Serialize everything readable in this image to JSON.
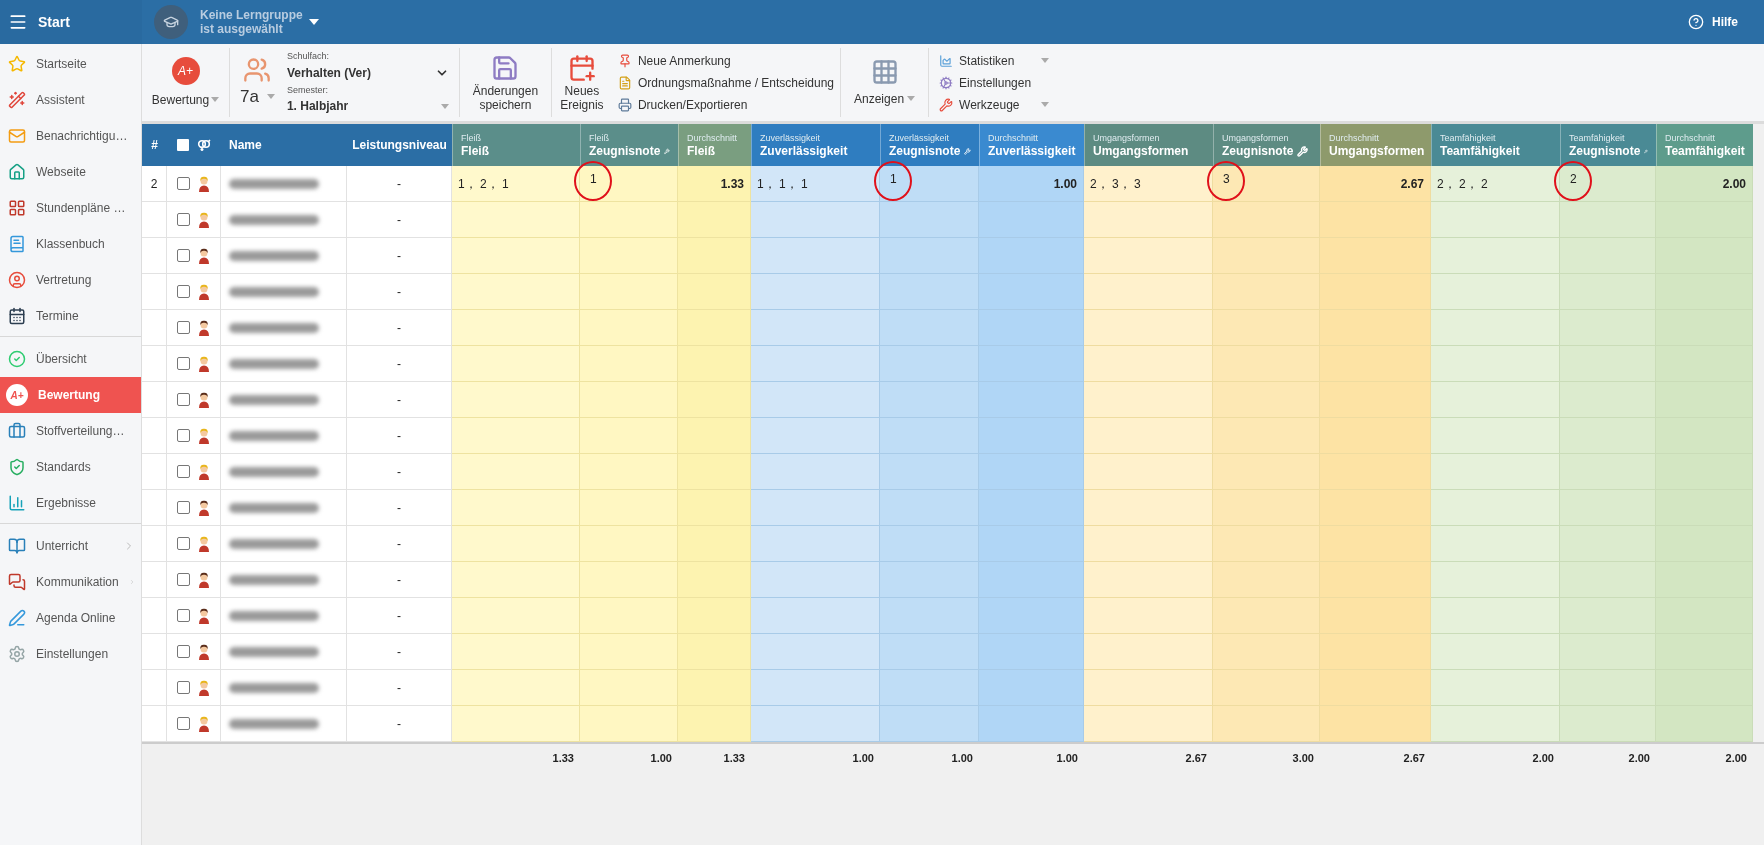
{
  "topbar": {
    "menu_label": "Start",
    "group_line1": "Keine Lerngruppe",
    "group_line2": "ist ausgewählt",
    "help": "Hilfe"
  },
  "sidebar": {
    "groups": [
      [
        {
          "label": "Startseite",
          "selected": false
        },
        {
          "label": "Assistent",
          "selected": false
        },
        {
          "label": "Benachrichtigu…",
          "selected": false
        },
        {
          "label": "Webseite",
          "selected": false
        },
        {
          "label": "Stundenpläne …",
          "selected": false
        },
        {
          "label": "Klassenbuch",
          "selected": false
        },
        {
          "label": "Vertretung",
          "selected": false
        },
        {
          "label": "Termine",
          "selected": false
        }
      ],
      [
        {
          "label": "Übersicht",
          "selected": false
        },
        {
          "label": "Bewertung",
          "badge": "A+",
          "selected": true
        },
        {
          "label": "Stoffverteilung…",
          "selected": false
        },
        {
          "label": "Standards",
          "selected": false
        },
        {
          "label": "Ergebnisse",
          "selected": false
        }
      ],
      [
        {
          "label": "Unterricht",
          "selected": false,
          "submenu": true
        },
        {
          "label": "Kommunikation",
          "selected": false,
          "submenu": true
        },
        {
          "label": "Agenda Online",
          "selected": false,
          "submenu": false
        },
        {
          "label": "Einstellungen",
          "selected": false,
          "submenu": false
        }
      ]
    ]
  },
  "toolbar": {
    "grading": {
      "badge": "A+",
      "label": "Bewertung"
    },
    "class_name": "7a",
    "subject_label": "Schulfach:",
    "subject": "Verhalten (Ver)",
    "semester_label": "Semester:",
    "semester": "1. Halbjahr",
    "save_line1": "Änderungen",
    "save_line2": "speichern",
    "event_line1": "Neues",
    "event_line2": "Ereignis",
    "actions": [
      {
        "label": "Neue Anmerkung"
      },
      {
        "label": "Ordnungsmaßnahme / Entscheidung"
      },
      {
        "label": "Drucken/Exportieren"
      }
    ],
    "view_label": "Anzeigen",
    "tools": [
      {
        "label": "Statistiken",
        "dropdown": true
      },
      {
        "label": "Einstellungen",
        "dropdown": false
      },
      {
        "label": "Werkzeuge",
        "dropdown": true
      }
    ]
  },
  "table": {
    "fixed_columns": [
      "#",
      "Name",
      "Leistungsniveau"
    ],
    "select_all_checked": false,
    "categories": [
      {
        "columns": [
          {
            "kind": "entries",
            "sub": "Fleiß",
            "label": "Fleiß"
          },
          {
            "kind": "grade",
            "sub": "Fleiß",
            "label": "Zeugnisnote"
          },
          {
            "kind": "average",
            "sub": "Durchschnitt",
            "label": "Fleiß"
          }
        ]
      },
      {
        "columns": [
          {
            "kind": "entries",
            "sub": "Zuverlässigkeit",
            "label": "Zuverlässigkeit"
          },
          {
            "kind": "grade",
            "sub": "Zuverlässigkeit",
            "label": "Zeugnisnote"
          },
          {
            "kind": "average",
            "sub": "Durchschnitt",
            "label": "Zuverlässigkeit"
          }
        ]
      },
      {
        "columns": [
          {
            "kind": "entries",
            "sub": "Umgangsformen",
            "label": "Umgangsformen"
          },
          {
            "kind": "grade",
            "sub": "Umgangsformen",
            "label": "Zeugnisnote"
          },
          {
            "kind": "average",
            "sub": "Durchschnitt",
            "label": "Umgangsformen"
          }
        ]
      },
      {
        "columns": [
          {
            "kind": "entries",
            "sub": "Teamfähigkeit",
            "label": "Teamfähigkeit"
          },
          {
            "kind": "grade",
            "sub": "Teamfähigkeit",
            "label": "Zeugnisnote"
          },
          {
            "kind": "average",
            "sub": "Durchschnitt",
            "label": "Teamfähigkeit"
          }
        ]
      }
    ],
    "rows": [
      {
        "number": "2",
        "kind": "female",
        "checked": false,
        "level": "-",
        "cells": [
          {
            "value": "1， 2， 1",
            "circled": false
          },
          {
            "value": "1",
            "circled": true
          },
          {
            "value": "1.33",
            "circled": false
          },
          {
            "value": "1， 1， 1",
            "circled": false
          },
          {
            "value": "1",
            "circled": true
          },
          {
            "value": "1.00",
            "circled": false
          },
          {
            "value": "2， 3， 3",
            "circled": false
          },
          {
            "value": "3",
            "circled": true
          },
          {
            "value": "2.67",
            "circled": false
          },
          {
            "value": "2， 2， 2",
            "circled": false
          },
          {
            "value": "2",
            "circled": true
          },
          {
            "value": "2.00",
            "circled": false
          }
        ]
      },
      {
        "kind": "female",
        "checked": false,
        "level": "-"
      },
      {
        "kind": "male",
        "checked": false,
        "level": "-"
      },
      {
        "kind": "female",
        "checked": false,
        "level": "-"
      },
      {
        "kind": "male",
        "checked": false,
        "level": "-"
      },
      {
        "kind": "female",
        "checked": false,
        "level": "-"
      },
      {
        "kind": "male",
        "checked": false,
        "level": "-"
      },
      {
        "kind": "female",
        "checked": false,
        "level": "-"
      },
      {
        "kind": "female",
        "checked": false,
        "level": "-"
      },
      {
        "kind": "male",
        "checked": false,
        "level": "-"
      },
      {
        "kind": "female",
        "checked": false,
        "level": "-"
      },
      {
        "kind": "male",
        "checked": false,
        "level": "-"
      },
      {
        "kind": "male",
        "checked": false,
        "level": "-"
      },
      {
        "kind": "male",
        "checked": false,
        "level": "-"
      },
      {
        "kind": "female",
        "checked": false,
        "level": "-"
      },
      {
        "kind": "female",
        "checked": false,
        "level": "-"
      }
    ],
    "totals": [
      "1.33",
      "1.00",
      "1.33",
      "1.00",
      "1.00",
      "1.00",
      "2.67",
      "3.00",
      "2.67",
      "2.00",
      "2.00",
      "2.00"
    ]
  }
}
